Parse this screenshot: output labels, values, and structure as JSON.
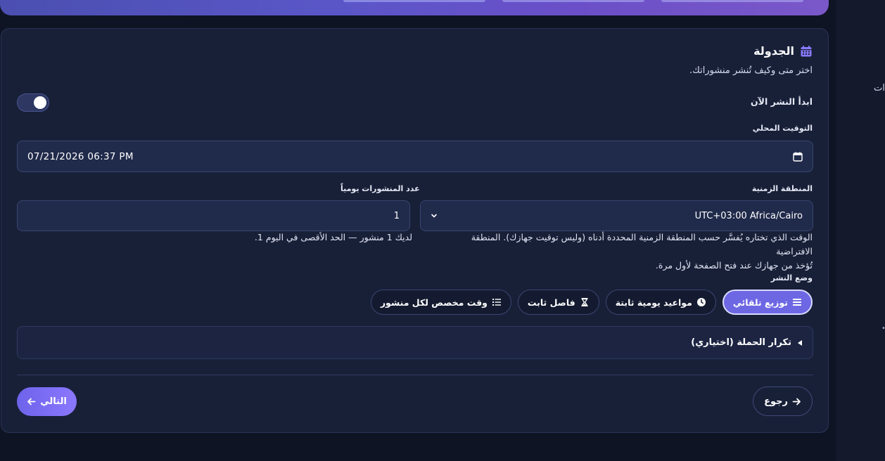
{
  "schedule": {
    "title": "الجدولة",
    "subtitle": "اختر متى وكيف تُنشر منشوراتك.",
    "start_now_label": "ابدأ النشر الآن",
    "start_now_on": true,
    "local_time_label": "التوقيت المحلي",
    "local_time_value": "07/21/2026  06:37 PM",
    "timezone_label": "المنطقة الزمنية",
    "timezone_value": "UTC+03:00 Africa/Cairo",
    "timezone_help_line1": "الوقت الذي تختاره يُفسَّر حسب المنطقة الزمنية المحددة أدناه (وليس توقيت جهازك). المنطقة الافتراضية",
    "timezone_help_line2": "تُؤخذ من جهازك عند فتح الصفحة لأول مرة.",
    "posts_per_day_label": "عدد المنشورات يومياً",
    "posts_per_day_value": "1",
    "posts_per_day_help": "لديك 1 منشور — الحد الأقصى في اليوم 1.",
    "mode_label": "وضع النشر",
    "modes": [
      {
        "label": "توزيع تلقائي",
        "icon": "list-icon",
        "active": true
      },
      {
        "label": "مواعيد يومية ثابتة",
        "icon": "clock-icon",
        "active": false
      },
      {
        "label": "فاصل ثابت",
        "icon": "hourglass-icon",
        "active": false
      },
      {
        "label": "وقت مخصص لكل منشور",
        "icon": "checklist-icon",
        "active": false
      }
    ],
    "campaign_repeat_label": "تكرار الحملة (اختياري)"
  },
  "nav": {
    "back_label": "رجوع",
    "next_label": "التالي"
  },
  "sidebar_fragment": "ات",
  "colors": {
    "accent": "#6d67e4",
    "card_bg": "#182038",
    "page_bg": "#0f1424"
  }
}
